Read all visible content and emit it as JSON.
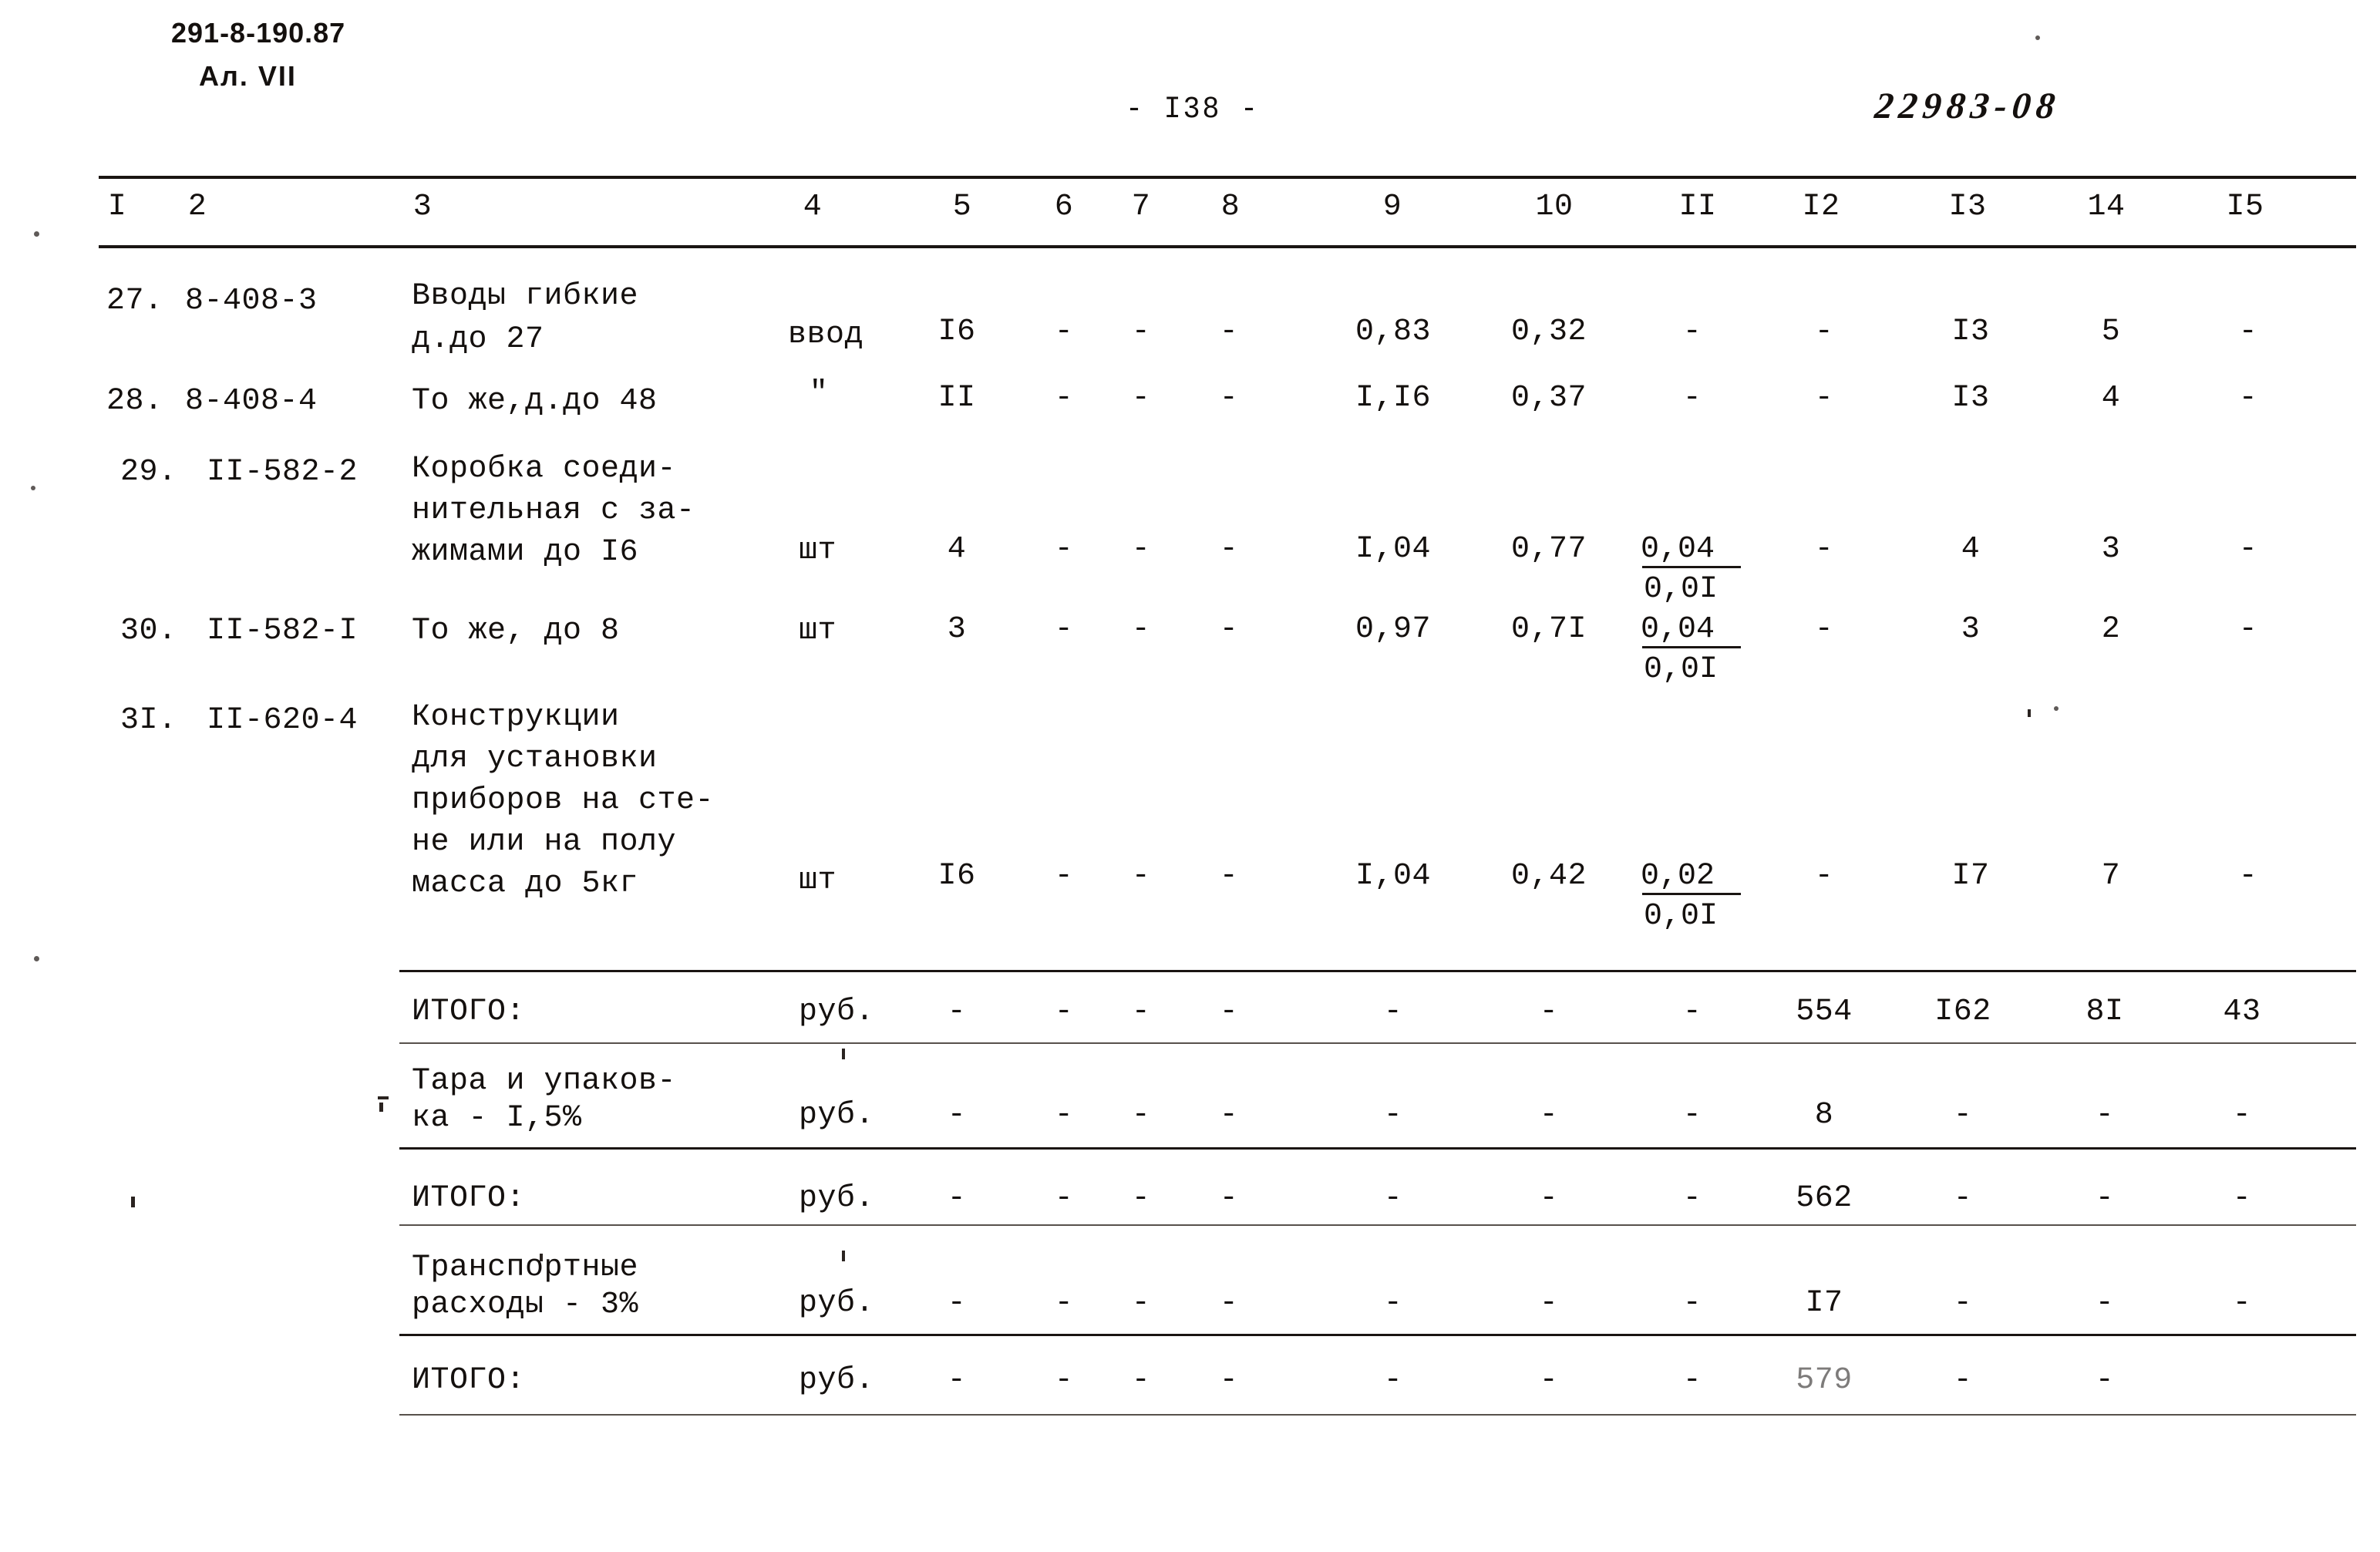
{
  "document": {
    "code_left": "291-8-190.87",
    "album_line": "Ал. VII",
    "page_number": "- I38 -",
    "archive_stamp": "22983-08"
  },
  "table": {
    "column_headers": [
      "I",
      "2",
      "3",
      "4",
      "5",
      "6",
      "7",
      "8",
      "9",
      "10",
      "II",
      "I2",
      "I3",
      "14",
      "I5"
    ],
    "rows": [
      {
        "no": "27.",
        "code": "8-408-3",
        "name_lines": [
          "Вводы гибкие",
          "д.до 27"
        ],
        "unit": "ввод",
        "qty": "I6",
        "c6": "-",
        "c7": "-",
        "c8": "-",
        "c9": "0,83",
        "c10": "0,32",
        "c11_num": "-",
        "c11_den": "",
        "c12": "-",
        "c13": "I3",
        "c14": "5",
        "c15": "-"
      },
      {
        "no": "28.",
        "code": "8-408-4",
        "name_lines": [
          "То же,д.до 48"
        ],
        "unit": "\"",
        "qty": "II",
        "c6": "-",
        "c7": "-",
        "c8": "-",
        "c9": "I,I6",
        "c10": "0,37",
        "c11_num": "-",
        "c11_den": "",
        "c12": "-",
        "c13": "I3",
        "c14": "4",
        "c15": "-"
      },
      {
        "no": "29.",
        "code": "II-582-2",
        "name_lines": [
          "Коробка соеди-",
          "нительная с за-",
          "жимами до I6"
        ],
        "unit": "шт",
        "qty": "4",
        "c6": "-",
        "c7": "-",
        "c8": "-",
        "c9": "I,04",
        "c10": "0,77",
        "c11_num": "0,04",
        "c11_den": "0,0I",
        "c12": "-",
        "c13": "4",
        "c14": "3",
        "c15": "-"
      },
      {
        "no": "30.",
        "code": "II-582-I",
        "name_lines": [
          "То же, до 8"
        ],
        "unit": "шт",
        "qty": "3",
        "c6": "-",
        "c7": "-",
        "c8": "-",
        "c9": "0,97",
        "c10": "0,7I",
        "c11_num": "0,04",
        "c11_den": "0,0I",
        "c12": "-",
        "c13": "3",
        "c14": "2",
        "c15": "-"
      },
      {
        "no": "3I.",
        "code": "II-620-4",
        "name_lines": [
          "Конструкции",
          "для установки",
          "приборов на сте-",
          "не или на полу",
          "масса до 5кг"
        ],
        "unit": "шт",
        "qty": "I6",
        "c6": "-",
        "c7": "-",
        "c8": "-",
        "c9": "I,04",
        "c10": "0,42",
        "c11_num": "0,02",
        "c11_den": "0,0I",
        "c12": "-",
        "c13": "I7",
        "c14": "7",
        "c15": "-"
      }
    ],
    "summary_rows": [
      {
        "label_lines": [
          "ИТОГО:"
        ],
        "unit": "руб.",
        "c5": "-",
        "c6": "-",
        "c7": "-",
        "c8": "-",
        "c9": "-",
        "c10": "-",
        "c11": "-",
        "c12": "554",
        "c13": "I62",
        "c14": "8I",
        "c15": "43"
      },
      {
        "label_lines": [
          "Тара и упаков-",
          "ка - I,5%"
        ],
        "unit": "руб.",
        "c5": "-",
        "c6": "-",
        "c7": "-",
        "c8": "-",
        "c9": "-",
        "c10": "-",
        "c11": "-",
        "c12": "8",
        "c13": "-",
        "c14": "-",
        "c15": "-"
      },
      {
        "label_lines": [
          "ИТОГО:"
        ],
        "unit": "руб.",
        "c5": "-",
        "c6": "-",
        "c7": "-",
        "c8": "-",
        "c9": "-",
        "c10": "-",
        "c11": "-",
        "c12": "562",
        "c13": "-",
        "c14": "-",
        "c15": "-"
      },
      {
        "label_lines": [
          "Транспортные",
          "расходы - 3%"
        ],
        "unit": "руб.",
        "c5": "-",
        "c6": "-",
        "c7": "-",
        "c8": "-",
        "c9": "-",
        "c10": "-",
        "c11": "-",
        "c12": "I7",
        "c13": "-",
        "c14": "-",
        "c15": "-"
      },
      {
        "label_lines": [
          "ИТОГО:"
        ],
        "unit": "руб.",
        "c5": "-",
        "c6": "-",
        "c7": "-",
        "c8": "-",
        "c9": "-",
        "c10": "-",
        "c11": "-",
        "c12": "579",
        "c13": "-",
        "c14": "-",
        "c15": "-"
      }
    ]
  }
}
